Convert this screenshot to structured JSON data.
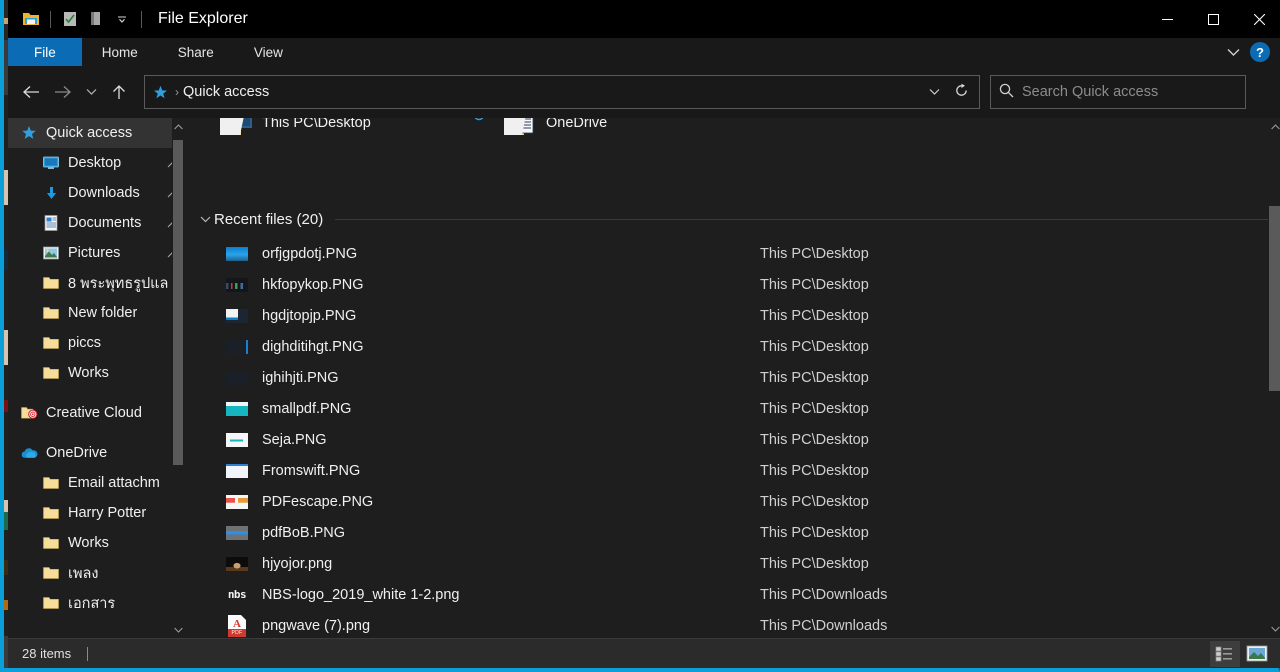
{
  "window": {
    "title": "File Explorer",
    "accent_color": "#0a9fd8",
    "minimize_label": "—",
    "maximize_label": "□",
    "close_label": "✕"
  },
  "quick_access_toolbar": {
    "items": [
      {
        "name": "explorer-icon",
        "label": ""
      },
      {
        "name": "properties-icon",
        "label": ""
      },
      {
        "name": "new-folder-icon",
        "label": ""
      },
      {
        "name": "customize-chevron-icon",
        "label": "⌄"
      }
    ]
  },
  "ribbon": {
    "tabs": [
      {
        "label": "File",
        "selected": true
      },
      {
        "label": "Home",
        "selected": false
      },
      {
        "label": "Share",
        "selected": false
      },
      {
        "label": "View",
        "selected": false
      }
    ],
    "expand_label": "⌄",
    "help_label": "?"
  },
  "toolbar": {
    "back_label": "←",
    "forward_label": "→",
    "recent_label": "⌄",
    "up_label": "↑"
  },
  "address": {
    "crumb_icon": "★",
    "separator": "›",
    "path": "Quick access",
    "dropdown_label": "⌄",
    "refresh_label": "↻"
  },
  "search": {
    "placeholder": "Search Quick access",
    "value": "",
    "icon_label": "⌕"
  },
  "sidebar": {
    "scroll_up_label": "⌃",
    "scroll_down_label": "⌄",
    "items": [
      {
        "label": "Quick access",
        "icon": "star-icon",
        "level": 0,
        "selected": true,
        "pinned": false
      },
      {
        "label": "Desktop",
        "icon": "desktop-icon",
        "level": 1,
        "selected": false,
        "pinned": true
      },
      {
        "label": "Downloads",
        "icon": "downloads-icon",
        "level": 1,
        "selected": false,
        "pinned": true
      },
      {
        "label": "Documents",
        "icon": "documents-icon",
        "level": 1,
        "selected": false,
        "pinned": true
      },
      {
        "label": "Pictures",
        "icon": "pictures-icon",
        "level": 1,
        "selected": false,
        "pinned": true
      },
      {
        "label": "8 พระพุทธรูปแล",
        "icon": "folder-icon",
        "level": 1,
        "selected": false,
        "pinned": false
      },
      {
        "label": "New folder",
        "icon": "folder-icon",
        "level": 1,
        "selected": false,
        "pinned": false
      },
      {
        "label": "piccs",
        "icon": "folder-icon",
        "level": 1,
        "selected": false,
        "pinned": false
      },
      {
        "label": "Works",
        "icon": "folder-icon",
        "level": 1,
        "selected": false,
        "pinned": false
      },
      {
        "label": "Creative Cloud",
        "icon": "creative-cloud-icon",
        "level": 0,
        "selected": false,
        "pinned": false
      },
      {
        "label": "OneDrive",
        "icon": "onedrive-icon",
        "level": 0,
        "selected": false,
        "pinned": false
      },
      {
        "label": "Email attachm",
        "icon": "folder-icon",
        "level": 1,
        "selected": false,
        "pinned": false
      },
      {
        "label": "Harry Potter",
        "icon": "folder-icon",
        "level": 1,
        "selected": false,
        "pinned": false
      },
      {
        "label": "Works",
        "icon": "folder-icon",
        "level": 1,
        "selected": false,
        "pinned": false
      },
      {
        "label": "เพลง",
        "icon": "folder-icon",
        "level": 1,
        "selected": false,
        "pinned": false
      },
      {
        "label": "เอกสาร",
        "icon": "folder-icon",
        "level": 1,
        "selected": false,
        "pinned": false
      }
    ]
  },
  "content": {
    "frequent_folders": [
      {
        "label": "This PC\\Desktop",
        "icon": "folder-picture-icon",
        "sync": false
      },
      {
        "label": "OneDrive",
        "icon": "folder-document-icon",
        "sync": true
      }
    ],
    "group": {
      "chevron": "⌄",
      "title": "Recent files (20)"
    },
    "files": [
      {
        "name": "orfjgpdotj.PNG",
        "path": "This PC\\Desktop",
        "thumb": "t-blue"
      },
      {
        "name": "hkfopykop.PNG",
        "path": "This PC\\Desktop",
        "thumb": "t-dark1"
      },
      {
        "name": "hgdjtopjp.PNG",
        "path": "This PC\\Desktop",
        "thumb": "t-win"
      },
      {
        "name": "dighditihgt.PNG",
        "path": "This PC\\Desktop",
        "thumb": "t-dark2"
      },
      {
        "name": "ighihjti.PNG",
        "path": "This PC\\Desktop",
        "thumb": "t-dark3"
      },
      {
        "name": "smallpdf.PNG",
        "path": "This PC\\Desktop",
        "thumb": "t-teal"
      },
      {
        "name": "Seja.PNG",
        "path": "This PC\\Desktop",
        "thumb": "t-white1"
      },
      {
        "name": "Fromswift.PNG",
        "path": "This PC\\Desktop",
        "thumb": "t-white2"
      },
      {
        "name": "PDFescape.PNG",
        "path": "This PC\\Desktop",
        "thumb": "t-white3"
      },
      {
        "name": "pdfBoB.PNG",
        "path": "This PC\\Desktop",
        "thumb": "t-gray"
      },
      {
        "name": "hjyojor.png",
        "path": "This PC\\Desktop",
        "thumb": "t-photo"
      },
      {
        "name": "NBS-logo_2019_white 1-2.png",
        "path": "This PC\\Downloads",
        "thumb": "t-nbs",
        "thumb_text": "nbs"
      },
      {
        "name": "pngwave (7).png",
        "path": "This PC\\Downloads",
        "thumb": "t-pdf",
        "thumb_text": "PDF"
      }
    ],
    "scroll_up_label": "⌃",
    "scroll_down_label": "⌄"
  },
  "statusbar": {
    "item_count": "28 items",
    "view_details_name": "details-view-icon",
    "view_large_icons_name": "large-icons-view-icon"
  }
}
